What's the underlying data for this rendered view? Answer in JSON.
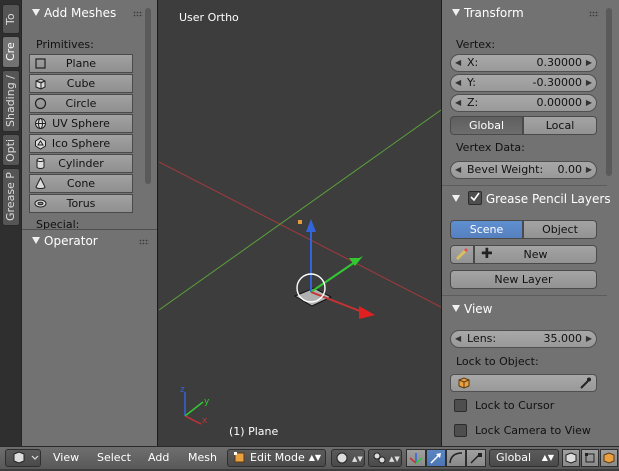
{
  "tabs": [
    "To",
    "Cre",
    "Shading /",
    "Opti",
    "Grease P"
  ],
  "toolshelf": {
    "add_meshes": {
      "title": "Add Meshes",
      "primitives_label": "Primitives:",
      "items": [
        {
          "label": "Plane",
          "icon": "plane-icon"
        },
        {
          "label": "Cube",
          "icon": "cube-icon"
        },
        {
          "label": "Circle",
          "icon": "circle-icon"
        },
        {
          "label": "UV Sphere",
          "icon": "uv-sphere-icon"
        },
        {
          "label": "Ico Sphere",
          "icon": "ico-sphere-icon"
        },
        {
          "label": "Cylinder",
          "icon": "cylinder-icon"
        },
        {
          "label": "Cone",
          "icon": "cone-icon"
        },
        {
          "label": "Torus",
          "icon": "torus-icon"
        }
      ],
      "special_label": "Special:"
    },
    "operator": {
      "title": "Operator"
    }
  },
  "viewport": {
    "title": "User Ortho",
    "object_label": "(1) Plane",
    "axis_x": "x",
    "axis_y": "y",
    "axis_z": "z"
  },
  "properties": {
    "transform": {
      "title": "Transform",
      "vertex_label": "Vertex:",
      "x_label": "X:",
      "x_value": "0.30000",
      "y_label": "Y:",
      "y_value": "-0.30000",
      "z_label": "Z:",
      "z_value": "0.00000",
      "global_label": "Global",
      "local_label": "Local",
      "vertex_data_label": "Vertex Data:",
      "bevel_label": "Bevel Weight:",
      "bevel_value": "0.00"
    },
    "grease_pencil": {
      "title": "Grease Pencil Layers",
      "scene_label": "Scene",
      "object_label": "Object",
      "new_label": "New",
      "new_layer_label": "New Layer"
    },
    "view": {
      "title": "View",
      "lens_label": "Lens:",
      "lens_value": "35.000",
      "lock_object_label": "Lock to Object:",
      "lock_cursor_label": "Lock to Cursor",
      "lock_camera_label": "Lock Camera to View"
    }
  },
  "header": {
    "menus": [
      "View",
      "Select",
      "Add",
      "Mesh"
    ],
    "mode": "Edit Mode",
    "orientation": "Global"
  },
  "colors": {
    "panel_bg": "#727272",
    "viewport_bg": "#3d3d3d",
    "accent_blue": "#5680c0",
    "axis_red": "#c83232",
    "axis_green": "#32c832",
    "axis_blue": "#3264dc"
  }
}
